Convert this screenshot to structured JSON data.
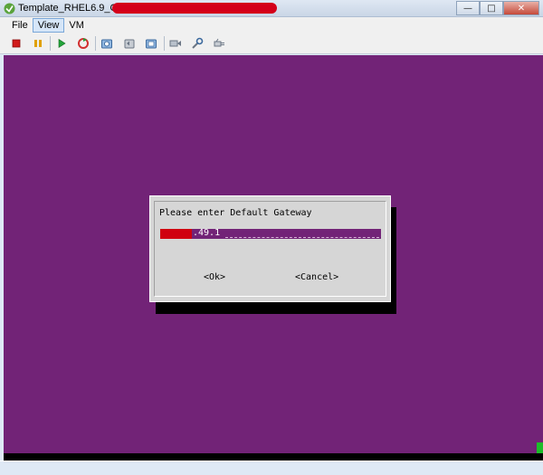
{
  "window": {
    "title": "Template_RHEL6.9_OS_x64",
    "redaction_color": "#d4001a",
    "controls": {
      "minimize": "—",
      "maximize": "□",
      "close": "✕"
    }
  },
  "menu": {
    "items": [
      {
        "label": "File"
      },
      {
        "label": "View"
      },
      {
        "label": "VM"
      }
    ]
  },
  "toolbar": {
    "buttons": [
      {
        "icon": "stop-square-icon",
        "color": "#d11b1b"
      },
      {
        "icon": "pause-icon",
        "color": "#e0a000"
      },
      {
        "icon": "play-icon",
        "color": "#22a43a"
      },
      {
        "icon": "reset-icon",
        "color": "#d23030"
      },
      {
        "icon": "snapshot-icon"
      },
      {
        "icon": "revert-snapshot-icon"
      },
      {
        "icon": "manage-snapshot-icon"
      },
      {
        "icon": "send-keys-icon"
      },
      {
        "icon": "settings-icon"
      },
      {
        "icon": "connect-device-icon"
      }
    ]
  },
  "console": {
    "background": "#722377",
    "dialog": {
      "prompt": "Please enter Default Gateway",
      "input_value": ".49.1",
      "ok_label": "<Ok>",
      "cancel_label": "<Cancel>"
    }
  },
  "status": {
    "indicator_color": "#1cbd2a"
  }
}
